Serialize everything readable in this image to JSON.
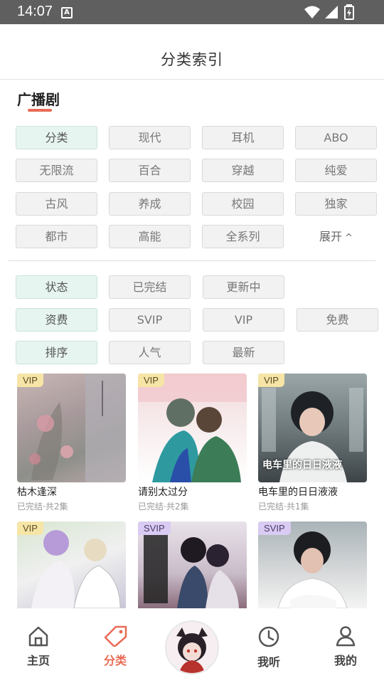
{
  "status_bar": {
    "time": "14:07",
    "a_icon": "A"
  },
  "header": {
    "title": "分类索引"
  },
  "section": {
    "title": "广播剧"
  },
  "filters": {
    "row1": [
      "分类",
      "现代",
      "耳机",
      "ABO"
    ],
    "row2": [
      "无限流",
      "百合",
      "穿越",
      "纯爱"
    ],
    "row3": [
      "古风",
      "养成",
      "校园",
      "独家"
    ],
    "row4": [
      "都市",
      "高能",
      "全系列"
    ],
    "expand_label": "展开",
    "status": [
      "状态",
      "已完结",
      "更新中"
    ],
    "fee": [
      "资费",
      "SVIP",
      "VIP",
      "免费"
    ],
    "sort": [
      "排序",
      "人气",
      "最新"
    ]
  },
  "cards": [
    {
      "badge": "VIP",
      "title": "枯木逢深",
      "sub": "已完结·共2集",
      "cover_text": ""
    },
    {
      "badge": "VIP",
      "title": "请别太过分",
      "sub": "已完结·共2集",
      "cover_text": ""
    },
    {
      "badge": "VIP",
      "title": "电车里的日日液液",
      "sub": "已完结·共1集",
      "cover_text": "电车里的日日液液"
    },
    {
      "badge": "VIP",
      "title": "",
      "sub": "",
      "cover_text": ""
    },
    {
      "badge": "SVIP",
      "title": "",
      "sub": "",
      "cover_text": ""
    },
    {
      "badge": "SVIP",
      "title": "",
      "sub": "",
      "cover_text": ""
    }
  ],
  "bottom_nav": {
    "home": "主页",
    "category": "分类",
    "listen": "我听",
    "mine": "我的"
  },
  "colors": {
    "accent": "#e96b55",
    "active_chip": "#e7f5f1",
    "vip_badge": "#f6e5a6",
    "svip_badge": "#d9cbf2"
  }
}
